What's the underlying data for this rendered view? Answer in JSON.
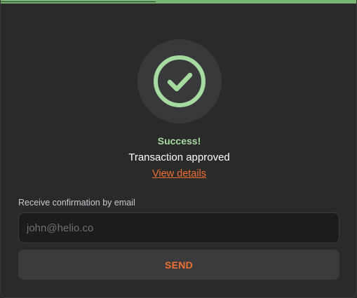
{
  "colors": {
    "accent": "#f07032",
    "success": "#a6dba0",
    "progress": "#6fae6a",
    "background": "#2a2a2b"
  },
  "progress": {
    "value_percent": 100
  },
  "status": {
    "icon": "check-circle-icon",
    "title": "Success!",
    "message": "Transaction approved",
    "details_link": "View details"
  },
  "email_form": {
    "label": "Receive confirmation by email",
    "value": "",
    "placeholder": "john@helio.co",
    "send_label": "SEND"
  }
}
